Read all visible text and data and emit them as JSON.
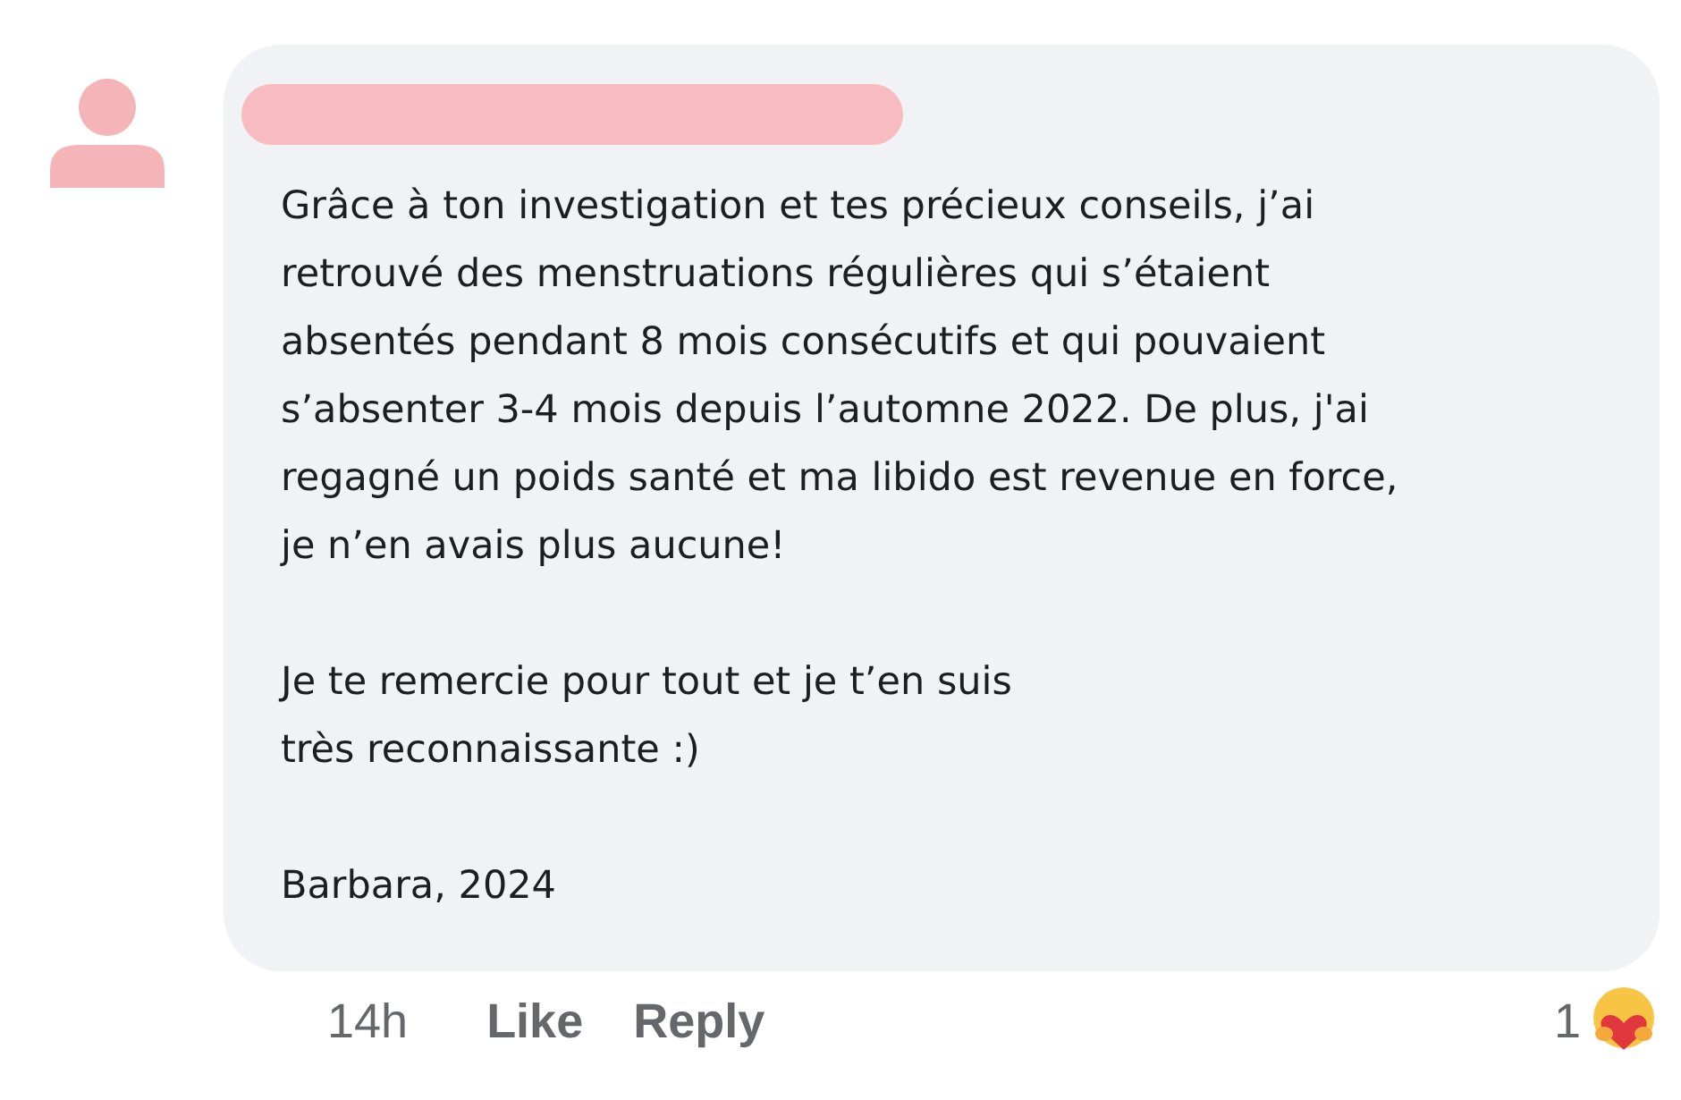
{
  "comment": {
    "paragraphs": [
      {
        "lines": [
          "Grâce à ton investigation et tes précieux conseils, j’ai",
          "retrouvé des menstruations régulières qui s’étaient",
          "absentés pendant 8 mois consécutifs et qui pouvaient",
          "s’absenter 3-4 mois depuis l’automne 2022. De plus, j'ai",
          "regagné un poids santé et ma libido est revenue en force,",
          "je n’en avais plus aucune!"
        ]
      },
      {
        "lines": [
          "Je te remercie pour tout et je t’en suis",
          "très reconnaissante :)"
        ]
      },
      {
        "lines": [
          "Barbara, 2024"
        ]
      }
    ]
  },
  "footer": {
    "time": "14h",
    "actions": [
      "Like",
      "Reply"
    ],
    "reaction_count": "1"
  }
}
